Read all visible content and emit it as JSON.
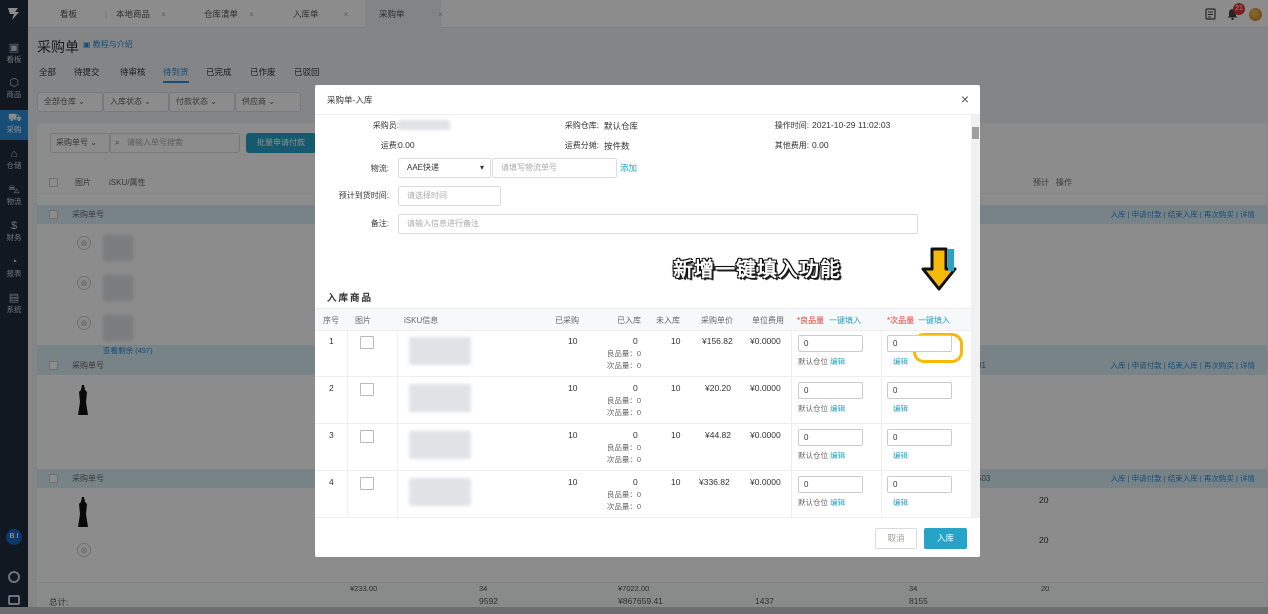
{
  "nav": {
    "items": [
      {
        "label": "看板",
        "icon": "dashboard-icon"
      },
      {
        "label": "商品",
        "icon": "box-icon"
      },
      {
        "label": "采购",
        "icon": "cart-icon"
      },
      {
        "label": "仓储",
        "icon": "warehouse-icon"
      },
      {
        "label": "物流",
        "icon": "truck-icon"
      },
      {
        "label": "财务",
        "icon": "finance-icon"
      },
      {
        "label": "报表",
        "icon": "chart-icon"
      },
      {
        "label": "系统",
        "icon": "system-icon"
      }
    ],
    "avatar_text": "B I"
  },
  "tabs": [
    {
      "label": "看板",
      "closable": false
    },
    {
      "label": "本地商品",
      "closable": true
    },
    {
      "label": "仓库清单",
      "closable": true
    },
    {
      "label": "入库单",
      "closable": true
    },
    {
      "label": "采购单",
      "closable": true
    }
  ],
  "notifications": {
    "count": "21"
  },
  "page": {
    "title": "采购单",
    "tutorial_link": "教程与介绍",
    "status_tabs": [
      "全部",
      "待提交",
      "待审核",
      "待到货",
      "已完成",
      "已作废",
      "已驳回"
    ],
    "filters": [
      "全部仓库",
      "入库状态",
      "付款状态",
      "供应商"
    ],
    "search": {
      "field": "采购单号",
      "placeholder": "请输入单号搜索",
      "bulk_button": "批量申请付款"
    },
    "table_headers": {
      "image": "图片",
      "isku": "iSKU/属性",
      "right": "预计",
      "ops": "操作"
    },
    "group_label": "采购单号",
    "group_ops": "入库 | 申请付款 | 结束入库 | 再次购买 | 详情",
    "view_all": "查看剩余 (497)",
    "frag_1": "81",
    "frag_2": "503",
    "frag_20a": "20",
    "frag_20b": "20",
    "totals": {
      "label": "总计:",
      "v1": "9592",
      "v2": "¥867659.41",
      "v3": "1437",
      "v4": "8155"
    },
    "partial_row": {
      "v1": "¥233.00",
      "v2": "34",
      "v3": "¥7022.00",
      "v4": "34",
      "v5": "20"
    }
  },
  "modal": {
    "title": "采购单-入库",
    "fields": {
      "buyer_label": "采购员:",
      "warehouse_label": "采购仓库:",
      "warehouse_value": "默认仓库",
      "optime_label": "操作时间:",
      "optime_value": "2021-10-29 11:02:03",
      "freight_label": "运费:",
      "freight_value": "0.00",
      "share_label": "运费分摊:",
      "share_value": "按件数",
      "other_label": "其他费用:",
      "other_value": "0.00",
      "logistics_label": "物流:",
      "logistics_value": "AAE快递",
      "tracking_placeholder": "请填写物流单号",
      "add_link": "添加",
      "eta_label": "预计到货时间:",
      "eta_placeholder": "请选择时间",
      "remark_label": "备注:",
      "remark_placeholder": "请输入信息进行备注"
    },
    "promo_text": "新增一键填入功能",
    "section_title": "入库商品",
    "goods_headers": [
      "序号",
      "图片",
      "iSKU信息",
      "已采购",
      "已入库",
      "未入库",
      "采购单价",
      "单位费用",
      "*良品量",
      "一键填入",
      "*次品量",
      "一键填入"
    ],
    "rows": [
      {
        "no": "1",
        "purchased": "10",
        "received": "0",
        "good": "良品量：0",
        "defect": "次品量：0",
        "pending": "10",
        "price": "¥156.82",
        "unit_fee": "¥0.0000",
        "good_qty": "0",
        "defect_qty": "0"
      },
      {
        "no": "2",
        "purchased": "10",
        "received": "0",
        "good": "良品量：0",
        "defect": "次品量：0",
        "pending": "10",
        "price": "¥20.20",
        "unit_fee": "¥0.0000",
        "good_qty": "0",
        "defect_qty": "0"
      },
      {
        "no": "3",
        "purchased": "10",
        "received": "0",
        "good": "良品量：0",
        "defect": "次品量：0",
        "pending": "10",
        "price": "¥44.82",
        "unit_fee": "¥0.0000",
        "good_qty": "0",
        "defect_qty": "0"
      },
      {
        "no": "4",
        "purchased": "10",
        "received": "0",
        "good": "良品量：0",
        "defect": "次品量：0",
        "pending": "10",
        "price": "¥336.82",
        "unit_fee": "¥0.0000",
        "good_qty": "0",
        "defect_qty": "0"
      }
    ],
    "default_location": "默认仓位",
    "edit_link": "编辑",
    "cancel_button": "取消",
    "confirm_button": "入库"
  },
  "colors": {
    "accent": "#26a3c6",
    "nav_bg": "#1f2d3d",
    "highlight": "#f5b90a",
    "badge": "#e53935"
  }
}
